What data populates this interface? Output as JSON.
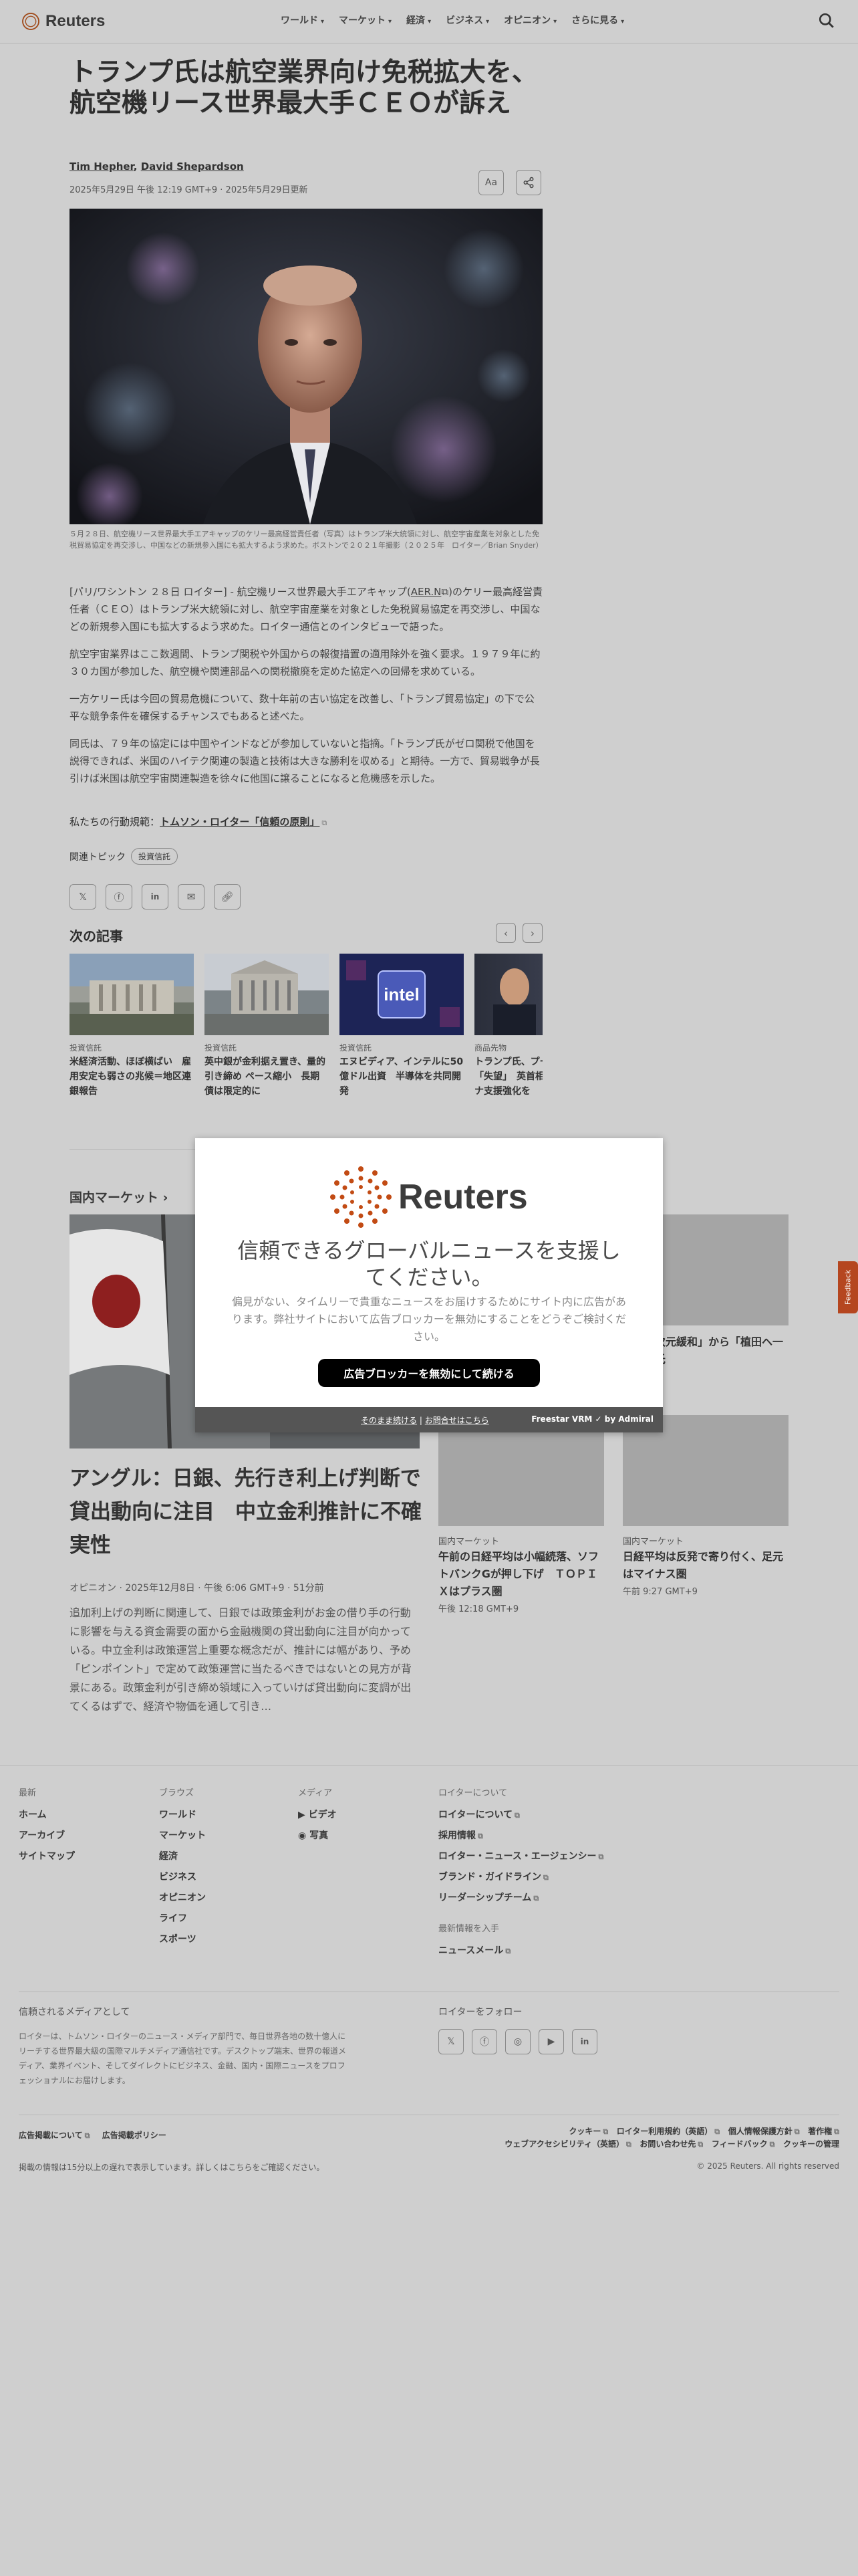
{
  "nav": {
    "logo": "Reuters",
    "items": [
      "ワールド",
      "マーケット",
      "経済",
      "ビジネス",
      "オピニオン",
      "さらに見る"
    ]
  },
  "article": {
    "title": "トランプ氏は航空業界向け免税拡大を、航空機リース世界最大手ＣＥＯが訴え",
    "author1": "Tim Hepher",
    "author_sep": ",",
    "author2": "David Shepardson",
    "date": "2025年5月29日 午後 12:19 GMT+9 · 2025年5月29日更新",
    "font_button": "Aa",
    "caption": "５月２８日、航空機リース世界最大手エアキャップのケリー最高経営責任者（写真）はトランプ米大統領に対し、航空宇宙産業を対象とした免税貿易協定を再交渉し、中国などの新規参入国にも拡大するよう求めた。ボストンで２０２１年撮影（２０２５年　ロイター／Brian Snyder）",
    "p1_a": "[パリ/ワシントン ２８日 ロイター] - 航空機リース世界最大手エアキャップ(",
    "p1_link": "AER.N",
    "p1_b": ")のケリー最高経営責任者（ＣＥＯ）はトランプ米大統領に対し、航空宇宙産業を対象とした免税貿易協定を再交渉し、中国などの新規参入国にも拡大するよう求めた。ロイター通信とのインタビューで語った。",
    "p2": "航空宇宙業界はここ数週間、トランプ関税や外国からの報復措置の適用除外を強く要求。１９７９年に約３０カ国が参加した、航空機や関連部品への関税撤廃を定めた協定への回帰を求めている。",
    "p3": "一方ケリー氏は今回の貿易危機について、数十年前の古い協定を改善し、「トランプ貿易協定」の下で公平な競争条件を確保するチャンスでもあると述べた。",
    "p4": "同氏は、７９年の協定には中国やインドなどが参加していないと指摘。「トランプ氏がゼロ関税で他国を説得できれば、米国のハイテク関連の製造と技術は大きな勝利を収める」と期待。一方で、貿易戦争が長引けば米国は航空宇宙関連製造を徐々に他国に譲ることになると危機感を示した。",
    "trust_prefix": "私たちの行動規範：",
    "trust_link": "トムソン・ロイター「信頼の原則」",
    "topics_label": "関連トピック",
    "topic_chip": "投資信託"
  },
  "next": {
    "heading": "次の記事",
    "cards": [
      {
        "category": "投資信託",
        "title": "米経済活動、ほぼ横ばい　雇用安定も弱さの兆候＝地区連銀報告"
      },
      {
        "category": "投資信託",
        "title": "英中銀が金利据え置き、量的引き締め ペース縮小　長期債は限定的に"
      },
      {
        "category": "投資信託",
        "title": "エヌビディア、インテルに50億ドル出資　半導体を共同開発"
      },
      {
        "category": "商品先物",
        "title": "トランプ氏、プーチン氏に「失望」　英首相とウクライナ支援強化を"
      }
    ]
  },
  "domestic": {
    "heading": "国内マーケット",
    "main_title": "アングル：日銀、先行き利上げ判断で貸出動向に注目　中立金利推計に不確実性",
    "main_meta": "オピニオン · 2025年12月8日 · 午後 6:06 GMT+9 · 51分前",
    "main_desc": "追加利上げの判断に関連して、日銀では政策金利がお金の借り手の行動に影響を与える資金需要の面から金融機関の貸出動向に注目が向かっている。中立金利は政策運営上重要な概念だが、推計には幅があり、予め「ピンポイント」で定めて政策運営に当たるべきではないとの見方が背景にある。政策金利が引き締め領域に入っていけば貸出動向に変調が出てくるはずで、経済や物価を通して引き…",
    "top_right_title": "「超異次元緩和」から「植田ヘ一問一夫氏",
    "top_right_time": "GMT+9",
    "cards": [
      {
        "category": "国内マーケット",
        "title": "午前の日経平均は小幅続落、ソフトバンクGが押し下げ　ＴＯＰＩＸはプラス圏",
        "time": "午後 12:18 GMT+9"
      },
      {
        "category": "国内マーケット",
        "title": "日経平均は反発で寄り付く、足元はマイナス圏",
        "time": "午前 9:27 GMT+9"
      }
    ]
  },
  "modal": {
    "logo": "Reuters",
    "title": "信頼できるグローバルニュースを支援してください。",
    "text": "偏見がない、タイムリーで貴重なニュースをお届けするためにサイト内に広告があります。弊社サイトにおいて広告ブロッカーを無効にすることをどうぞご検討ください。",
    "button": "広告ブロッカーを無効にして続ける",
    "link1": "そのまま続ける",
    "link_sep": " | ",
    "link2": "お問合せはこちら",
    "brand": "Freestar VRM ✓ by Admiral"
  },
  "feedback": "Feedback",
  "footer": {
    "latest": {
      "heading": "最新",
      "items": [
        "ホーム",
        "アーカイブ",
        "サイトマップ"
      ]
    },
    "browse": {
      "heading": "ブラウズ",
      "items": [
        "ワールド",
        "マーケット",
        "経済",
        "ビジネス",
        "オピニオン",
        "ライフ",
        "スポーツ"
      ]
    },
    "media": {
      "heading": "メディア",
      "items": [
        "ビデオ",
        "写真"
      ]
    },
    "about": {
      "heading": "ロイターについて",
      "items": [
        "ロイターについて",
        "採用情報",
        "ロイター・ニュース・エージェンシー",
        "ブランド・ガイドライン",
        "リーダーシップチーム"
      ]
    },
    "info": {
      "heading": "最新情報を入手",
      "items": [
        "ニュースメール"
      ]
    },
    "trusted_heading": "信頼されるメディアとして",
    "trusted_text": "ロイターは、トムソン・ロイターのニュース・メディア部門で、毎日世界各地の数十億人にリーチする世界最大級の国際マルチメディア通信社です。デスクトップ端末、世界の報道メディア、業界イベント、そしてダイレクトにビジネス、金融、国内・国際ニュースをプロフェッショナルにお届けします。",
    "follow_heading": "ロイターをフォロー",
    "ads1": "広告掲載について",
    "ads2": "広告掲載ポリシー",
    "legal_row1": [
      "クッキー",
      "ロイター利用規約（英語）",
      "個人情報保護方針",
      "著作権"
    ],
    "legal_row2": [
      "ウェブアクセシビリティ（英語）",
      "お問い合わせ先",
      "フィードバック",
      "クッキーの管理"
    ],
    "note": "掲載の情報は15分以上の遅れで表示しています。詳しくはこちらをご確認ください。",
    "copyright": "© 2025 Reuters. All rights reserved"
  }
}
